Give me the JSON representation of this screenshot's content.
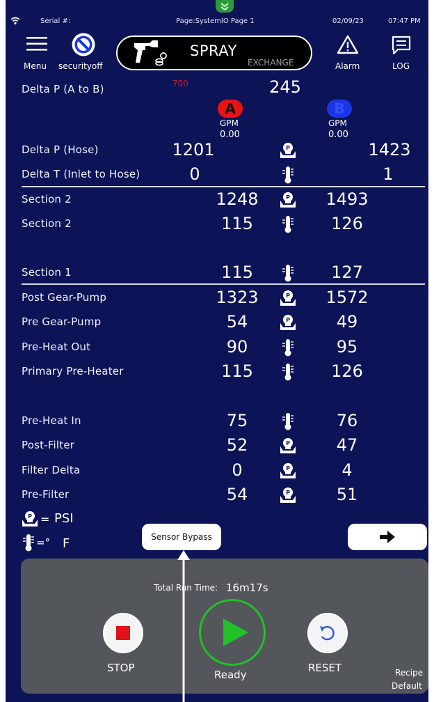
{
  "status": {
    "serial_label": "Serial #:",
    "page_label": "Page:SystemIO Page 1",
    "date": "02/09/23",
    "time": "07:47 PM"
  },
  "toolbar": {
    "menu_label": "Menu",
    "security_label": "securityoff",
    "spray_title": "SPRAY",
    "spray_sub": "EXCHANGE",
    "alarm_label": "Alarm",
    "log_label": "LOG"
  },
  "delta_ab": {
    "label": "Delta P (A to B)",
    "setpoint": "700",
    "value": "245"
  },
  "gpm": {
    "a_letter": "A",
    "b_letter": "B",
    "a_unit": "GPM",
    "b_unit": "GPM",
    "a_value": "0.00",
    "b_value": "0.00"
  },
  "rows": [
    {
      "label": "Delta P (Hose)",
      "a": "1201",
      "b": "1423",
      "icon": "pressure-icon"
    },
    {
      "label": "Delta T (Inlet to Hose)",
      "a": "0",
      "b": "1",
      "icon": "thermometer-icon"
    },
    {
      "label": "Section 2",
      "a": "1248",
      "b": "1493",
      "icon": "pressure-icon"
    },
    {
      "label": "Section 2",
      "a": "115",
      "b": "126",
      "icon": "thermometer-icon"
    },
    {
      "label": "Section 1",
      "a": "115",
      "b": "127",
      "icon": "thermometer-icon"
    },
    {
      "label": "Post Gear-Pump",
      "a": "1323",
      "b": "1572",
      "icon": "pressure-icon"
    },
    {
      "label": "Pre Gear-Pump",
      "a": "54",
      "b": "49",
      "icon": "pressure-icon"
    },
    {
      "label": "Pre-Heat Out",
      "a": "90",
      "b": "95",
      "icon": "thermometer-icon"
    },
    {
      "label": "Primary Pre-Heater",
      "a": "115",
      "b": "126",
      "icon": "thermometer-icon"
    },
    {
      "label": "Pre-Heat In",
      "a": "75",
      "b": "76",
      "icon": "thermometer-icon"
    },
    {
      "label": "Post-Filter",
      "a": "52",
      "b": "47",
      "icon": "pressure-icon"
    },
    {
      "label": "Filter Delta",
      "a": "0",
      "b": "4",
      "icon": "pressure-icon"
    },
    {
      "label": "Pre-Filter",
      "a": "54",
      "b": "51",
      "icon": "pressure-icon"
    }
  ],
  "legend": {
    "psi_label": "PSI",
    "temp_label": "F"
  },
  "sensor_bypass_label": "Sensor Bypass",
  "next_arrow": "➡",
  "control": {
    "run_time_label": "Total Run Time:",
    "run_time_value": "16m17s",
    "stop_label": "STOP",
    "ready_label": "Ready",
    "reset_label": "RESET",
    "recipe_label": "Recipe",
    "recipe_value": "Default"
  },
  "colors": {
    "background": "#0c1356",
    "stop_red": "#e2121a",
    "ready_green": "#21c12a",
    "a_red": "#e81414",
    "b_blue": "#1a36e6",
    "setpoint_red": "#d11a2a"
  }
}
